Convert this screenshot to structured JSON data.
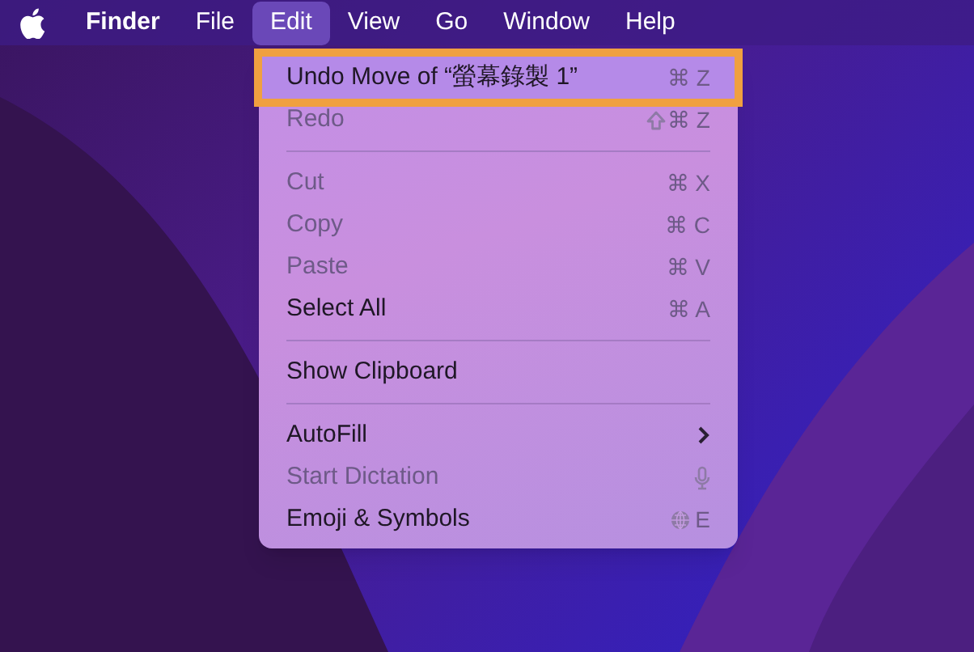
{
  "menu_bar": {
    "items": [
      {
        "label": "Finder",
        "selected": false,
        "bold": true
      },
      {
        "label": "File",
        "selected": false,
        "bold": false
      },
      {
        "label": "Edit",
        "selected": true,
        "bold": false
      },
      {
        "label": "View",
        "selected": false,
        "bold": false
      },
      {
        "label": "Go",
        "selected": false,
        "bold": false
      },
      {
        "label": "Window",
        "selected": false,
        "bold": false
      },
      {
        "label": "Help",
        "selected": false,
        "bold": false
      }
    ]
  },
  "menu": {
    "items": [
      {
        "kind": "item",
        "label": "Undo Move of “螢幕錄製 1”",
        "disabled": false,
        "selected": true,
        "accessory": {
          "kind": "shortcut",
          "text": "⌘ Z"
        }
      },
      {
        "kind": "item",
        "label": "Redo",
        "disabled": true,
        "selected": false,
        "accessory": {
          "kind": "shift-shortcut",
          "text": "⌘ Z"
        }
      },
      {
        "kind": "separator"
      },
      {
        "kind": "item",
        "label": "Cut",
        "disabled": true,
        "selected": false,
        "accessory": {
          "kind": "shortcut",
          "text": "⌘ X"
        }
      },
      {
        "kind": "item",
        "label": "Copy",
        "disabled": true,
        "selected": false,
        "accessory": {
          "kind": "shortcut",
          "text": "⌘ C"
        }
      },
      {
        "kind": "item",
        "label": "Paste",
        "disabled": true,
        "selected": false,
        "accessory": {
          "kind": "shortcut",
          "text": "⌘ V"
        }
      },
      {
        "kind": "item",
        "label": "Select All",
        "disabled": false,
        "selected": false,
        "accessory": {
          "kind": "shortcut",
          "text": "⌘ A"
        }
      },
      {
        "kind": "separator"
      },
      {
        "kind": "item",
        "label": "Show Clipboard",
        "disabled": false,
        "selected": false
      },
      {
        "kind": "separator"
      },
      {
        "kind": "item",
        "label": "AutoFill",
        "disabled": false,
        "selected": false,
        "accessory": {
          "kind": "submenu"
        }
      },
      {
        "kind": "item",
        "label": "Start Dictation",
        "disabled": true,
        "selected": false,
        "accessory": {
          "kind": "mic"
        }
      },
      {
        "kind": "item",
        "label": "Emoji & Symbols",
        "disabled": false,
        "selected": false,
        "accessory": {
          "kind": "globe",
          "text": "E"
        }
      }
    ]
  }
}
